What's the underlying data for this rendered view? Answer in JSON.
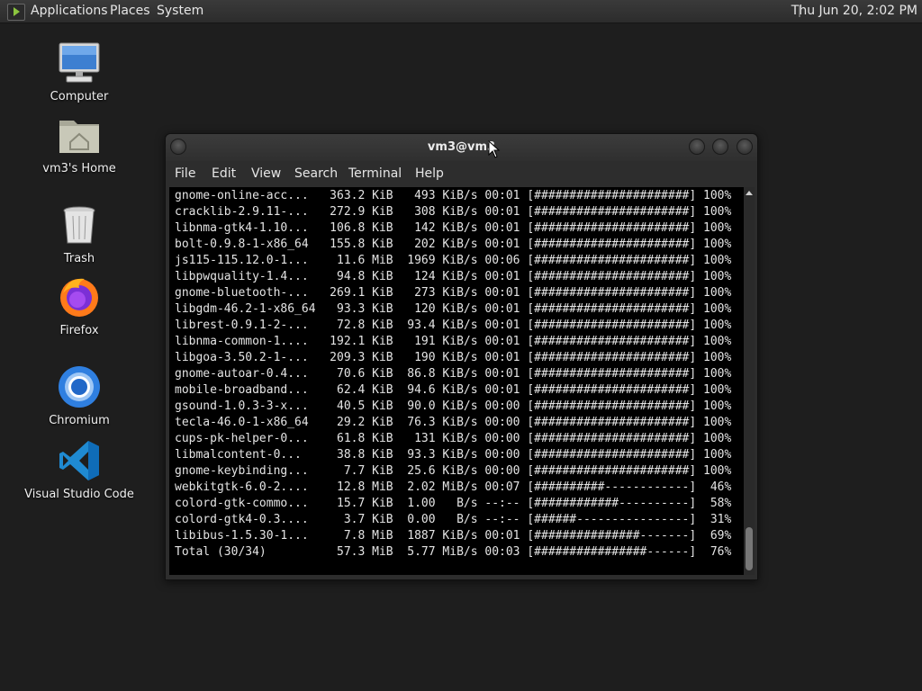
{
  "top_panel": {
    "menus": [
      "Applications",
      "Places",
      "System"
    ],
    "clock": "Thu Jun 20,  2:02 PM"
  },
  "desktop": {
    "icons": [
      {
        "label": "Computer",
        "icon": "computer-icon"
      },
      {
        "label": "vm3's Home",
        "icon": "home-folder-icon"
      },
      {
        "label": "Trash",
        "icon": "trash-icon"
      },
      {
        "label": "Firefox",
        "icon": "firefox-icon"
      },
      {
        "label": "Chromium",
        "icon": "chromium-icon"
      },
      {
        "label": "Visual Studio Code",
        "icon": "vscode-icon"
      }
    ]
  },
  "terminal": {
    "title": "vm3@vm3",
    "menus": [
      "File",
      "Edit",
      "View",
      "Search",
      "Terminal",
      "Help"
    ],
    "lines": [
      "gnome-online-acc...   363.2 KiB   493 KiB/s 00:01 [######################] 100%",
      "cracklib-2.9.11-...   272.9 KiB   308 KiB/s 00:01 [######################] 100%",
      "libnma-gtk4-1.10...   106.8 KiB   142 KiB/s 00:01 [######################] 100%",
      "bolt-0.9.8-1-x86_64   155.8 KiB   202 KiB/s 00:01 [######################] 100%",
      "js115-115.12.0-1...    11.6 MiB  1969 KiB/s 00:06 [######################] 100%",
      "libpwquality-1.4...    94.8 KiB   124 KiB/s 00:01 [######################] 100%",
      "gnome-bluetooth-...   269.1 KiB   273 KiB/s 00:01 [######################] 100%",
      "libgdm-46.2-1-x86_64   93.3 KiB   120 KiB/s 00:01 [######################] 100%",
      "librest-0.9.1-2-...    72.8 KiB  93.4 KiB/s 00:01 [######################] 100%",
      "libnma-common-1....   192.1 KiB   191 KiB/s 00:01 [######################] 100%",
      "libgoa-3.50.2-1-...   209.3 KiB   190 KiB/s 00:01 [######################] 100%",
      "gnome-autoar-0.4...    70.6 KiB  86.8 KiB/s 00:01 [######################] 100%",
      "mobile-broadband...    62.4 KiB  94.6 KiB/s 00:01 [######################] 100%",
      "gsound-1.0.3-3-x...    40.5 KiB  90.0 KiB/s 00:00 [######################] 100%",
      "tecla-46.0-1-x86_64    29.2 KiB  76.3 KiB/s 00:00 [######################] 100%",
      "cups-pk-helper-0...    61.8 KiB   131 KiB/s 00:00 [######################] 100%",
      "libmalcontent-0...     38.8 KiB  93.3 KiB/s 00:00 [######################] 100%",
      "gnome-keybinding...     7.7 KiB  25.6 KiB/s 00:00 [######################] 100%",
      "webkitgtk-6.0-2....    12.8 MiB  2.02 MiB/s 00:07 [##########------------]  46%",
      "colord-gtk-commo...    15.7 KiB  1.00   B/s --:-- [############----------]  58%",
      "colord-gtk4-0.3....     3.7 KiB  0.00   B/s --:-- [######----------------]  31%",
      "libibus-1.5.30-1...     7.8 MiB  1887 KiB/s 00:01 [###############-------]  69%",
      "Total (30/34)          57.3 MiB  5.77 MiB/s 00:03 [################------]  76%"
    ]
  }
}
